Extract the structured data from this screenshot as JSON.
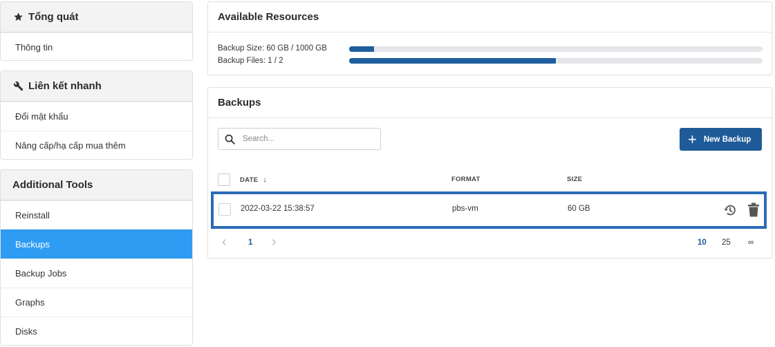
{
  "sidebar": {
    "overview": {
      "title": "Tổng quát",
      "icon": "star-icon",
      "items": [
        "Thông tin"
      ]
    },
    "quicklinks": {
      "title": "Liên kết nhanh",
      "icon": "wrench-icon",
      "items": [
        "Đổi mật khẩu",
        "Nâng cấp/hạ cấp mua thêm"
      ]
    },
    "tools": {
      "title": "Additional Tools",
      "items": [
        "Reinstall",
        "Backups",
        "Backup Jobs",
        "Graphs",
        "Disks"
      ],
      "active": "Backups"
    }
  },
  "resources": {
    "title": "Available Resources",
    "rows": [
      {
        "label": "Backup Size: 60 GB / 1000 GB",
        "fraction": 0.06
      },
      {
        "label": "Backup Files: 1 / 2",
        "fraction": 0.5
      }
    ]
  },
  "backups": {
    "title": "Backups",
    "search_placeholder": "Search...",
    "new_button": "New Backup",
    "columns": {
      "date": "DATE",
      "sort_arrow": "↓",
      "format": "FORMAT",
      "size": "SIZE"
    },
    "rows": [
      {
        "date": "2022-03-22 15:38:57",
        "format": "pbs-vm",
        "size": "60 GB"
      }
    ],
    "pagination": {
      "prev": "‹",
      "page": "1",
      "next": "›",
      "sizes": [
        "10",
        "25",
        "∞"
      ],
      "selected_size": "10"
    }
  },
  "colors": {
    "accent": "#2f9cf3",
    "primary": "#1e5b98",
    "highlight_border": "#2b6cb7"
  }
}
